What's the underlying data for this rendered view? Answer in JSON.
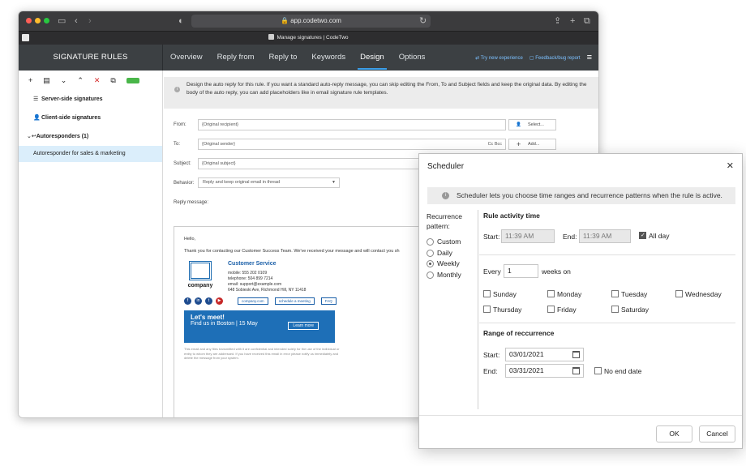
{
  "browser": {
    "url": "app.codetwo.com",
    "tab_title": "Manage signatures | CodeTwo"
  },
  "app": {
    "title": "SIGNATURE RULES",
    "nav_tabs": [
      "Overview",
      "Reply from",
      "Reply to",
      "Keywords",
      "Design",
      "Options"
    ],
    "active_tab": "Design",
    "try_new": "Try new experience",
    "feedback": "Feedback/bug report"
  },
  "sidebar": {
    "items": [
      {
        "label": "Server-side signatures",
        "icon": "server-icon"
      },
      {
        "label": "Client-side signatures",
        "icon": "user-icon"
      },
      {
        "label": "Autoresponders (1)",
        "icon": "reply-icon"
      },
      {
        "label": "Autoresponder for sales & marketing",
        "icon": ""
      }
    ]
  },
  "main": {
    "info": "Design the auto reply for this rule. If you want a standard auto-reply message, you can skip editing the From, To and Subject fields and keep the original data. By editing the body of the auto reply, you can add placeholders like in email signature rule templates.",
    "from_label": "From:",
    "from_value": "{Original recipient}",
    "select_label": "Select...",
    "to_label": "To:",
    "to_value": "{Original sender}",
    "cc_bcc": "Cc  Bcc",
    "add_label": "Add...",
    "subject_label": "Subject:",
    "subject_value": "{Original subject}",
    "behavior_label": "Behavior:",
    "behavior_value": "Reply and keep original email in thread",
    "reply_label": "Reply message:",
    "greeting": "Hello,",
    "body": "Thank you for contacting our Customer Success Team. We've received your message and will contact you sh",
    "company": "company",
    "sig_title": "Customer Service",
    "mobile": "mobile: 555 202 0109",
    "telephone": "telephone: 504 899 7214",
    "email": "email: support@example.com",
    "address": "648 Sobieski Ave, Richmond Hill, NY 11418",
    "links": [
      "company.com",
      "schedule a meeting",
      "FAQ"
    ],
    "banner_title": "Let's meet!",
    "banner_sub": "Find us in Boston | 15 May",
    "banner_btn": "Learn more",
    "disclaimer": "This email and any files transmitted with it are confidential and intended solely for the use of the individual or entity to whom they are addressed. If you have received this email in error please notify us immediately and delete the message from your system."
  },
  "scheduler": {
    "title": "Scheduler",
    "info": "Scheduler lets you choose time ranges and recurrence patterns when the rule is active.",
    "recurrence_label": "Recurrence pattern:",
    "patterns": [
      "Custom",
      "Daily",
      "Weekly",
      "Monthly"
    ],
    "selected_pattern": "Weekly",
    "activity_title": "Rule activity time",
    "start_label": "Start:",
    "start_time": "11:39 AM",
    "end_label": "End:",
    "end_time": "11:39 AM",
    "all_day": "All day",
    "every_label": "Every",
    "every_value": "1",
    "weeks_on": "weeks on",
    "days": [
      "Sunday",
      "Monday",
      "Tuesday",
      "Wednesday",
      "Thursday",
      "Friday",
      "Saturday"
    ],
    "range_title": "Range of reccurrence",
    "range_start_label": "Start:",
    "range_start": "03/01/2021",
    "range_end_label": "End:",
    "range_end": "03/31/2021",
    "no_end": "No end date",
    "ok": "OK",
    "cancel": "Cancel"
  }
}
